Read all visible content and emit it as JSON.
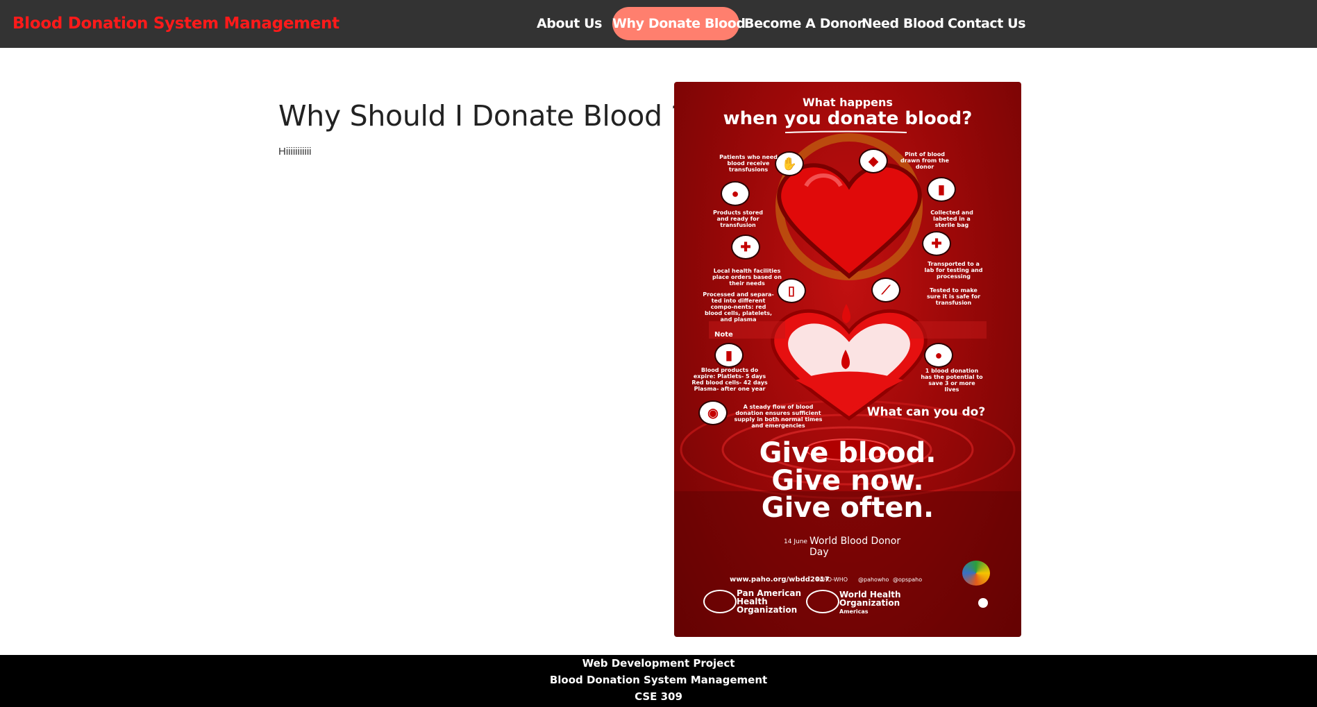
{
  "navbar": {
    "brand": "Blood Donation System Management",
    "links": [
      {
        "label": "About Us",
        "active": false
      },
      {
        "label": "Why Donate Blood",
        "active": true
      },
      {
        "label": "Become A Donor",
        "active": false
      },
      {
        "label": "Need Blood",
        "active": false
      },
      {
        "label": "Contact Us",
        "active": false
      }
    ]
  },
  "main": {
    "title": "Why Should I Donate Blood ?",
    "paragraph": "Hiiiiiiiiiii"
  },
  "poster": {
    "header_small": "What happens",
    "header_large": "when you donate blood?",
    "captions": {
      "patients": "Patients who need blood receive transfusions",
      "pint": "Pint of blood drawn from the donor",
      "stored": "Products stored and ready for transfusion",
      "collected": "Collected and labeted in a sterile bag",
      "local": "Local health facilities place orders based on their needs",
      "transported": "Transported to a lab for testing and processing",
      "processed": "Processed and separa-ted into different compo-nents: red blood cells, platelets, and plasma",
      "tested": "Tested to make sure it is safe for transfusion",
      "note_label": "Note",
      "expire": "Blood products do expire: Platlets- 5 days Red blood cells- 42 days Plasma- after one year",
      "lives": "1 blood donation has the potential to save 3 or more lives",
      "steady": "A steady flow of blood donation ensures sufficient supply in both normal times and emergencies"
    },
    "what_can": "What can you do?",
    "give1": "Give blood.",
    "give2": "Give now.",
    "give3": "Give often.",
    "day_date": "14 June",
    "day_name": "World Blood Donor Day",
    "website": "www.paho.org/wbdd2017",
    "social_fb": "PAHO-WHO",
    "social_tw": "@pahowho",
    "social_yt": "@opspaho",
    "org1": "Pan American Health Organization",
    "org2": "World Health Organization",
    "org2_sub": "Americas",
    "colors": {
      "heart": "#e00a0a",
      "accent": "#ff7f6e",
      "nav": "#333333"
    }
  },
  "footer": {
    "line1": "Web Development Project",
    "line2": "Blood Donation System Management",
    "line3": "CSE 309"
  }
}
